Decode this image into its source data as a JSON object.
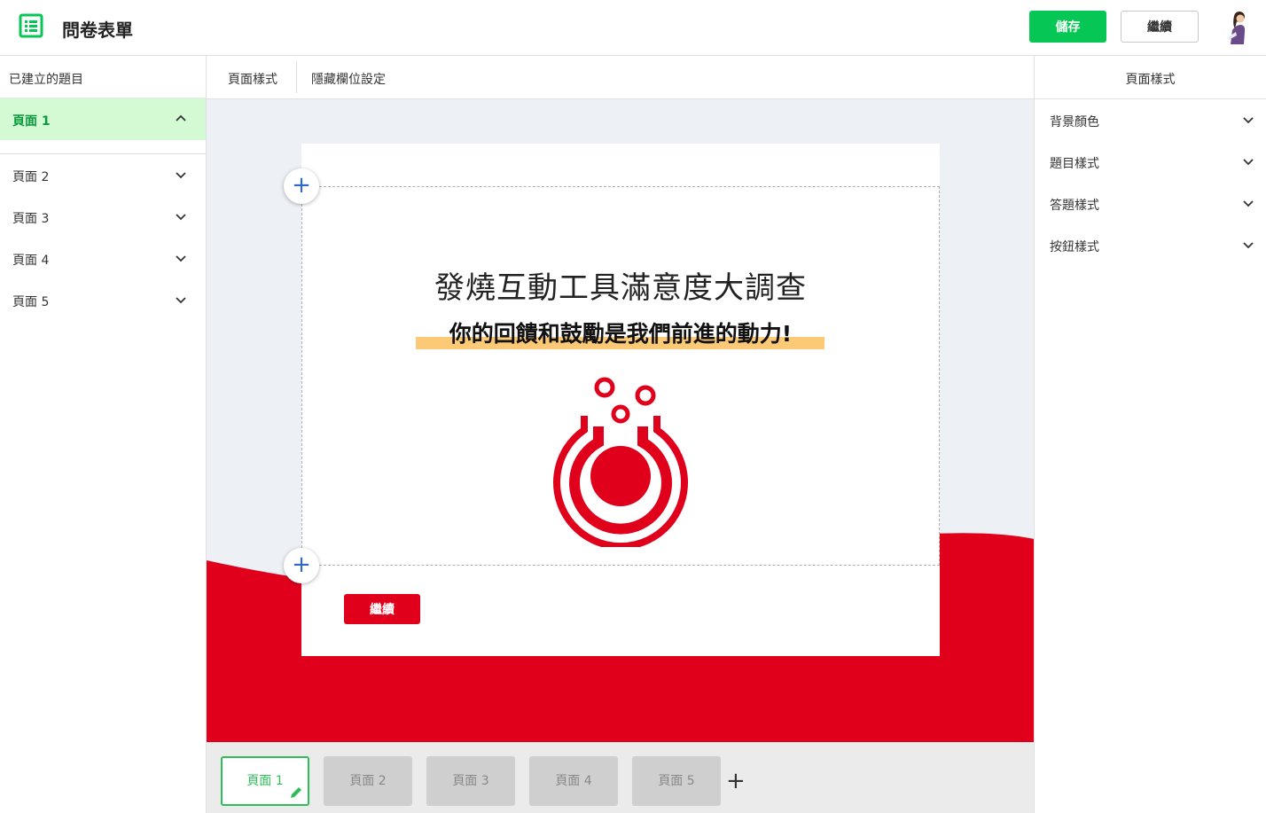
{
  "header": {
    "app_title": "問卷表單",
    "save_label": "儲存",
    "continue_label": "繼續",
    "brand_color": "#06c755"
  },
  "sidebar": {
    "title": "已建立的題目",
    "items": [
      {
        "label": "頁面 1",
        "expanded": true
      },
      {
        "label": "頁面 2",
        "expanded": false
      },
      {
        "label": "頁面 3",
        "expanded": false
      },
      {
        "label": "頁面 4",
        "expanded": false
      },
      {
        "label": "頁面 5",
        "expanded": false
      }
    ]
  },
  "center_tabs": [
    "頁面樣式",
    "隱藏欄位設定"
  ],
  "card": {
    "title": "發燒互動工具滿意度大調查",
    "subtitle": "你的回饋和鼓勵是我們前進的動力!",
    "continue_label": "繼續",
    "accent_color": "#e0001b",
    "highlight_color": "#fcc976"
  },
  "page_tabs": [
    {
      "label": "頁面 1",
      "active": true
    },
    {
      "label": "頁面 2",
      "active": false
    },
    {
      "label": "頁面 3",
      "active": false
    },
    {
      "label": "頁面 4",
      "active": false
    },
    {
      "label": "頁面 5",
      "active": false
    }
  ],
  "right_panel": {
    "title": "頁面樣式",
    "items": [
      "背景顏色",
      "題目樣式",
      "答題樣式",
      "按鈕樣式"
    ]
  },
  "icons": {
    "app": "form-list-icon",
    "add": "plus-icon",
    "expand": "chevron-down-icon",
    "collapse": "chevron-up-icon",
    "edit": "pencil-icon"
  }
}
